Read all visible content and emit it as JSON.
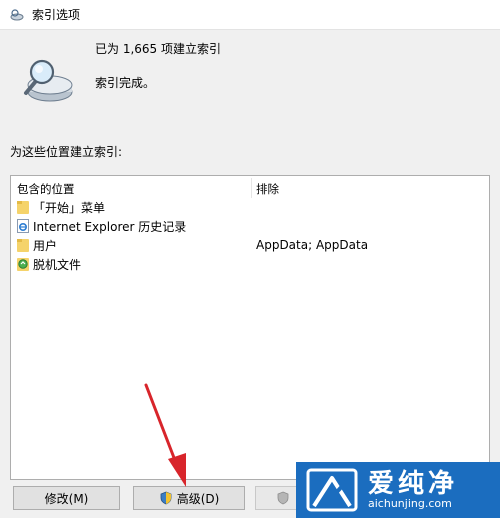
{
  "window": {
    "title": "索引选项"
  },
  "status": {
    "count_text": "已为 1,665 项建立索引",
    "state_text": "索引完成。"
  },
  "locations": {
    "section_label": "为这些位置建立索引:",
    "columns": {
      "included": "包含的位置",
      "excluded": "排除"
    },
    "rows": [
      {
        "name": "「开始」菜单",
        "icon": "folder-icon",
        "exclude": ""
      },
      {
        "name": "Internet Explorer 历史记录",
        "icon": "internet-explorer-icon",
        "exclude": ""
      },
      {
        "name": "用户",
        "icon": "folder-icon",
        "exclude": "AppData; AppData"
      },
      {
        "name": "脱机文件",
        "icon": "offline-files-icon",
        "exclude": ""
      }
    ]
  },
  "buttons": {
    "modify": "修改(M)",
    "advanced": "高级(D)"
  },
  "watermark": {
    "title": "爱纯净",
    "url": "aichunjing.com"
  },
  "colors": {
    "annotation_arrow": "#d8252b",
    "watermark_bg": "#1b6dbf",
    "folder": "#f5d36a"
  }
}
